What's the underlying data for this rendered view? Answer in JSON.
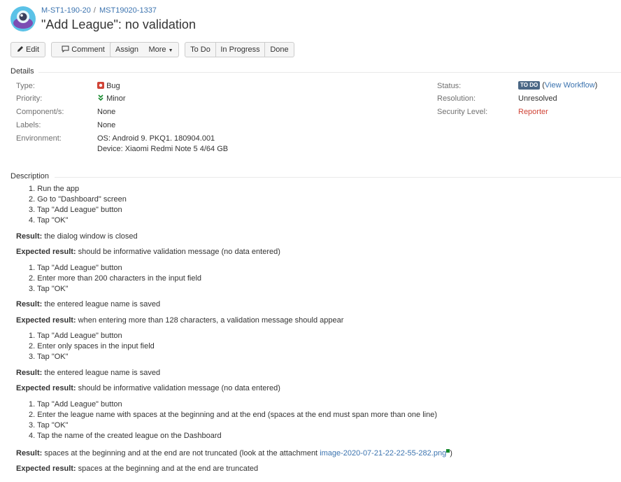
{
  "header": {
    "breadcrumb_project": "M-ST1-190-20",
    "breadcrumb_separator": "/",
    "breadcrumb_issue": "MST19020-1337",
    "title": "\"Add League\": no validation"
  },
  "toolbar": {
    "edit": "Edit",
    "comment": "Comment",
    "assign": "Assign",
    "more": "More",
    "todo": "To Do",
    "in_progress": "In Progress",
    "done": "Done"
  },
  "details": {
    "heading": "Details",
    "type_label": "Type:",
    "type_value": "Bug",
    "priority_label": "Priority:",
    "priority_value": "Minor",
    "component_label": "Component/s:",
    "component_value": "None",
    "labels_label": "Labels:",
    "labels_value": "None",
    "environment_label": "Environment:",
    "environment_line1": "OS: Android 9. PKQ1. 180904.001",
    "environment_line2": "Device: Xiaomi Redmi Note 5 4/64 GB",
    "status_label": "Status:",
    "status_badge": "TO DO",
    "status_link": "View Workflow",
    "resolution_label": "Resolution:",
    "resolution_value": "Unresolved",
    "security_label": "Security Level:",
    "security_value": "Reporter",
    "colors": {
      "bug": "#d04437",
      "priority": "#14892c",
      "reporter": "#d04437",
      "link": "#3b73af"
    }
  },
  "description": {
    "heading": "Description",
    "block1_steps": [
      "1. Run the app",
      "2. Go to \"Dashboard\" screen",
      "3. Tap \"Add League\" button",
      "4. Tap \"OK\""
    ],
    "result_label": "Result:",
    "expected_label": "Expected result:",
    "block1_result": "the dialog window is closed",
    "block1_expected": "should be informative validation message (no data entered)",
    "block2_steps": [
      "1. Tap \"Add League\" button",
      "2. Enter more than 200 characters in the input field",
      "3. Tap \"OK\""
    ],
    "block2_result": "the entered league name is saved",
    "block2_expected": "when entering more than 128 characters, a validation message should appear",
    "block3_steps": [
      "1. Tap \"Add League\" button",
      "2. Enter only spaces in the input field",
      "3. Tap \"OK\""
    ],
    "block3_result": "the entered league name is saved",
    "block3_expected": "should be informative validation message (no data entered)",
    "block4_steps": [
      "1. Tap \"Add League\" button",
      "2. Enter the league name with spaces at the beginning and at the end (spaces at the end must span more than one line)",
      "3. Tap \"OK\"",
      "4. Tap the name of the created league on the Dashboard"
    ],
    "block4_result_prefix": "spaces at the beginning and at the end are not truncated (look at the attachment",
    "block4_attachment": "image-2020-07-21-22-22-55-282.png",
    "block4_result_suffix": ")",
    "block4_expected": "spaces at the beginning and at the end are truncated"
  }
}
